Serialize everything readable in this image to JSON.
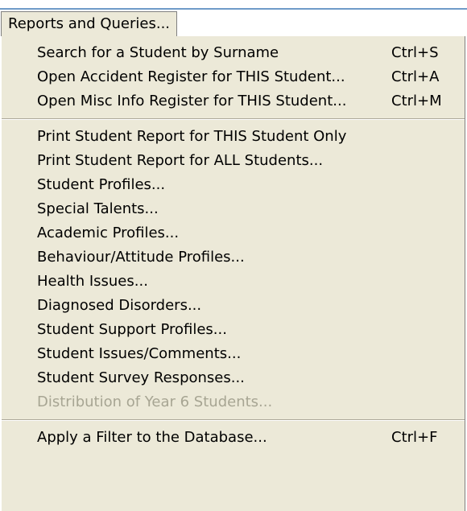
{
  "menu": {
    "title": "Reports and Queries...",
    "groups": [
      {
        "items": [
          {
            "label": "Search for a Student by Surname",
            "shortcut": "Ctrl+S"
          },
          {
            "label": "Open Accident Register for THIS Student...",
            "shortcut": "Ctrl+A"
          },
          {
            "label": "Open Misc Info Register for THIS Student...",
            "shortcut": "Ctrl+M"
          }
        ]
      },
      {
        "items": [
          {
            "label": "Print Student Report for THIS Student Only"
          },
          {
            "label": "Print Student Report for ALL Students..."
          },
          {
            "label": "Student Profiles..."
          },
          {
            "label": "Special Talents..."
          },
          {
            "label": "Academic Profiles..."
          },
          {
            "label": "Behaviour/Attitude Profiles..."
          },
          {
            "label": "Health Issues..."
          },
          {
            "label": "Diagnosed Disorders..."
          },
          {
            "label": "Student Support Profiles..."
          },
          {
            "label": "Student Issues/Comments..."
          },
          {
            "label": "Student Survey Responses..."
          },
          {
            "label": "Distribution of Year 6 Students...",
            "disabled": true
          }
        ]
      },
      {
        "items": [
          {
            "label": "Apply a Filter to the Database...",
            "shortcut": "Ctrl+F"
          }
        ]
      }
    ]
  }
}
